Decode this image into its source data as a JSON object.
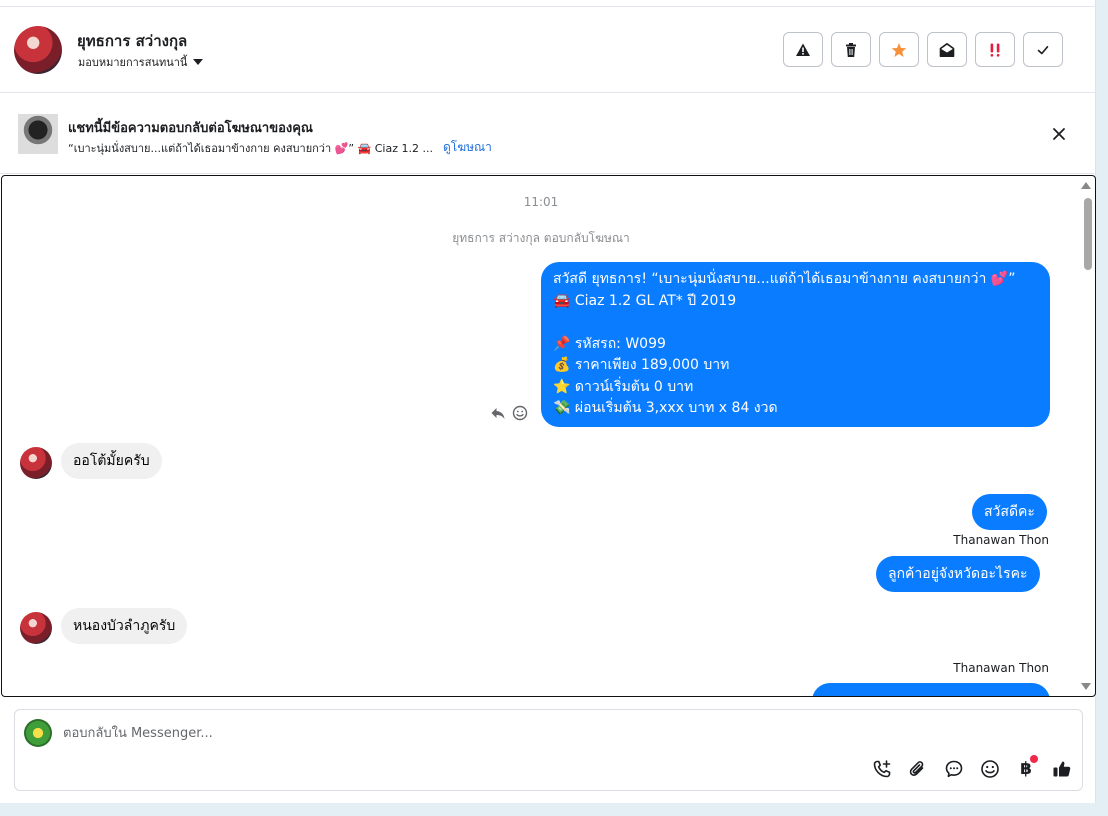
{
  "header": {
    "contact_name": "ยุทธการ สว่างกุล",
    "assign_label": "มอบหมายการสนทนานี้",
    "actions": [
      {
        "name": "spam-icon",
        "color": "#1c1e21"
      },
      {
        "name": "trash-icon",
        "color": "#1c1e21"
      },
      {
        "name": "star-icon",
        "color": "#f7923a"
      },
      {
        "name": "mail-open-icon",
        "color": "#1c1e21"
      },
      {
        "name": "priority-icon",
        "color": "#e41e3f"
      },
      {
        "name": "check-icon",
        "color": "#1c1e21"
      }
    ]
  },
  "ad_banner": {
    "title": "แชทนี้มีข้อความตอบกลับต่อโฆษณาของคุณ",
    "preview": "“เบาะนุ่มนั่งสบาย...แต่ถ้าได้เธอมาข้างกาย คงสบายกว่า 💕” 🚘 Ciaz 1.2 ...",
    "link": "ดูโฆษณา"
  },
  "chat": {
    "timestamp": "11:01",
    "system_note": "ยุทธการ สว่างกุล ตอบกลับโฆษณา",
    "messages": [
      {
        "id": "m1",
        "direction": "out",
        "text": "สวัสดี ยุทธการ! “เบาะนุ่มนั่งสบาย...แต่ถ้าได้เธอมาข้างกาย คงสบายกว่า 💕”\n🚘 Ciaz 1.2 GL AT* ปี 2019\n\n📌 รหัสรถ: W099\n💰 ราคาเพียง 189,000 บาท\n⭐ ดาวน์เริ่มต้น 0 บาท\n💸 ผ่อนเริ่มต้น 3,xxx บาท x 84 งวด"
      },
      {
        "id": "m2",
        "direction": "in",
        "text": "ออโต้มั้ยครับ"
      },
      {
        "id": "m3",
        "direction": "out",
        "text": "สวัสดีคะ"
      },
      {
        "id": "m4",
        "direction": "out",
        "sender": "Thanawan Thon",
        "text": "ลูกค้าอยู่จังหวัดอะไรคะ"
      },
      {
        "id": "m5",
        "direction": "in",
        "text": "หนองบัวลำภูครับ"
      },
      {
        "id": "m6",
        "direction": "out",
        "sender": "Thanawan Thon",
        "text": ""
      }
    ]
  },
  "composer": {
    "placeholder": "ตอบกลับใน Messenger...",
    "tools": [
      "call-add-icon",
      "attach-icon",
      "saved-reply-icon",
      "emoji-icon",
      "baht-payment-icon",
      "like-icon"
    ]
  },
  "colors": {
    "outgoing_bubble": "#0a7cff",
    "incoming_bubble": "#f0f0f0",
    "link": "#216fdb"
  }
}
